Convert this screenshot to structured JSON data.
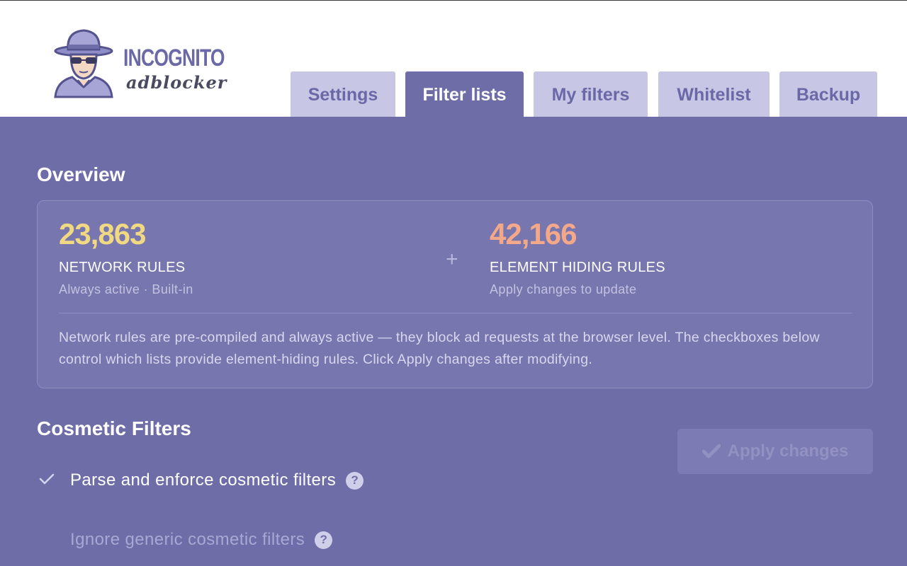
{
  "brand": {
    "name": "INCOGNITO",
    "tagline": "adblocker"
  },
  "tabs": [
    {
      "label": "Settings",
      "active": false
    },
    {
      "label": "Filter lists",
      "active": true
    },
    {
      "label": "My filters",
      "active": false
    },
    {
      "label": "Whitelist",
      "active": false
    },
    {
      "label": "Backup",
      "active": false
    }
  ],
  "overview": {
    "title": "Overview",
    "network": {
      "count": "23,863",
      "label": "NETWORK RULES",
      "sub": "Always active · Built-in",
      "color": "#f0d982"
    },
    "separator": "+",
    "element_hiding": {
      "count": "42,166",
      "label": "ELEMENT HIDING RULES",
      "sub": "Apply changes to update",
      "color": "#f4a88a"
    },
    "description": "Network rules are pre-compiled and always active — they block ad requests at the browser level. The checkboxes below control which lists provide element-hiding rules. Click Apply changes after modifying."
  },
  "cosmetic": {
    "title": "Cosmetic Filters",
    "apply_label": "Apply changes",
    "options": [
      {
        "label": "Parse and enforce cosmetic filters",
        "checked": true,
        "help": "?"
      },
      {
        "label": "Ignore generic cosmetic filters",
        "checked": false,
        "help": "?"
      }
    ]
  },
  "colors": {
    "panel": "#6f6da8",
    "tab_inactive": "#c7c6e4",
    "tab_text": "#6a68a6"
  }
}
